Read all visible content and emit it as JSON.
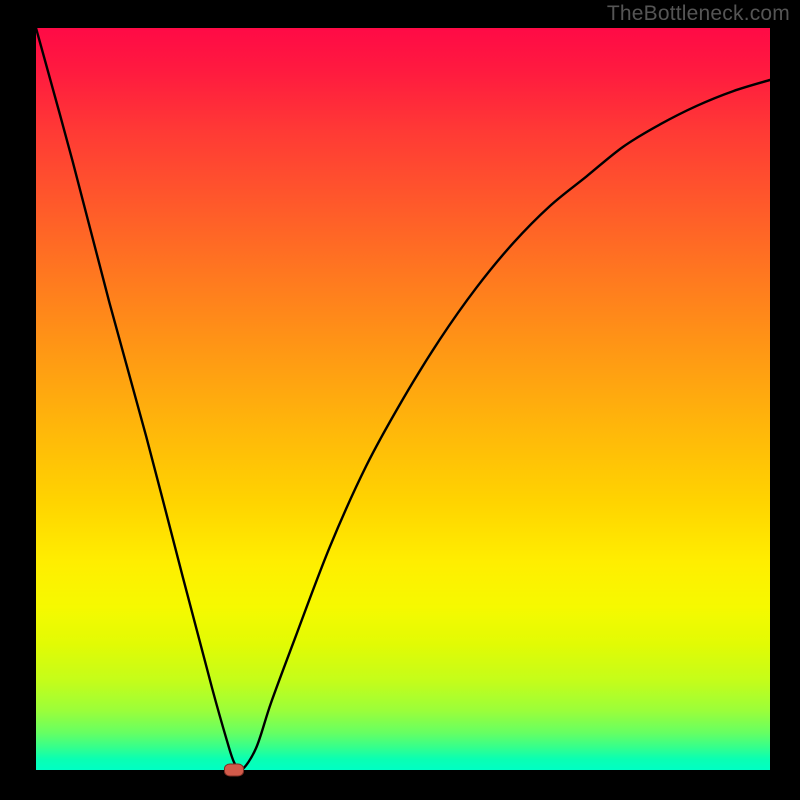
{
  "watermark": "TheBottleneck.com",
  "colors": {
    "frame": "#000000",
    "curve": "#000000",
    "marker_fill": "#d15a4a",
    "marker_border": "#7a2c22"
  },
  "chart_data": {
    "type": "line",
    "title": "",
    "xlabel": "",
    "ylabel": "",
    "xlim": [
      0,
      100
    ],
    "ylim": [
      0,
      100
    ],
    "grid": false,
    "legend": false,
    "annotations": [],
    "series": [
      {
        "name": "bottleneck-curve",
        "x": [
          0,
          5,
          10,
          15,
          20,
          24,
          26,
          27,
          28,
          30,
          32,
          35,
          40,
          45,
          50,
          55,
          60,
          65,
          70,
          75,
          80,
          85,
          90,
          95,
          100
        ],
        "y": [
          100,
          82,
          63,
          45,
          26,
          11,
          4,
          1,
          0,
          3,
          9,
          17,
          30,
          41,
          50,
          58,
          65,
          71,
          76,
          80,
          84,
          87,
          89.5,
          91.5,
          93
        ]
      }
    ],
    "marker": {
      "x": 27,
      "y": 0
    },
    "gradient_stops": [
      {
        "pct": 0,
        "color": "#ff0a46"
      },
      {
        "pct": 24,
        "color": "#ff5a2a"
      },
      {
        "pct": 54,
        "color": "#ffb70a"
      },
      {
        "pct": 72,
        "color": "#ffee00"
      },
      {
        "pct": 92,
        "color": "#9bfe3a"
      },
      {
        "pct": 100,
        "color": "#00ffc4"
      }
    ]
  }
}
